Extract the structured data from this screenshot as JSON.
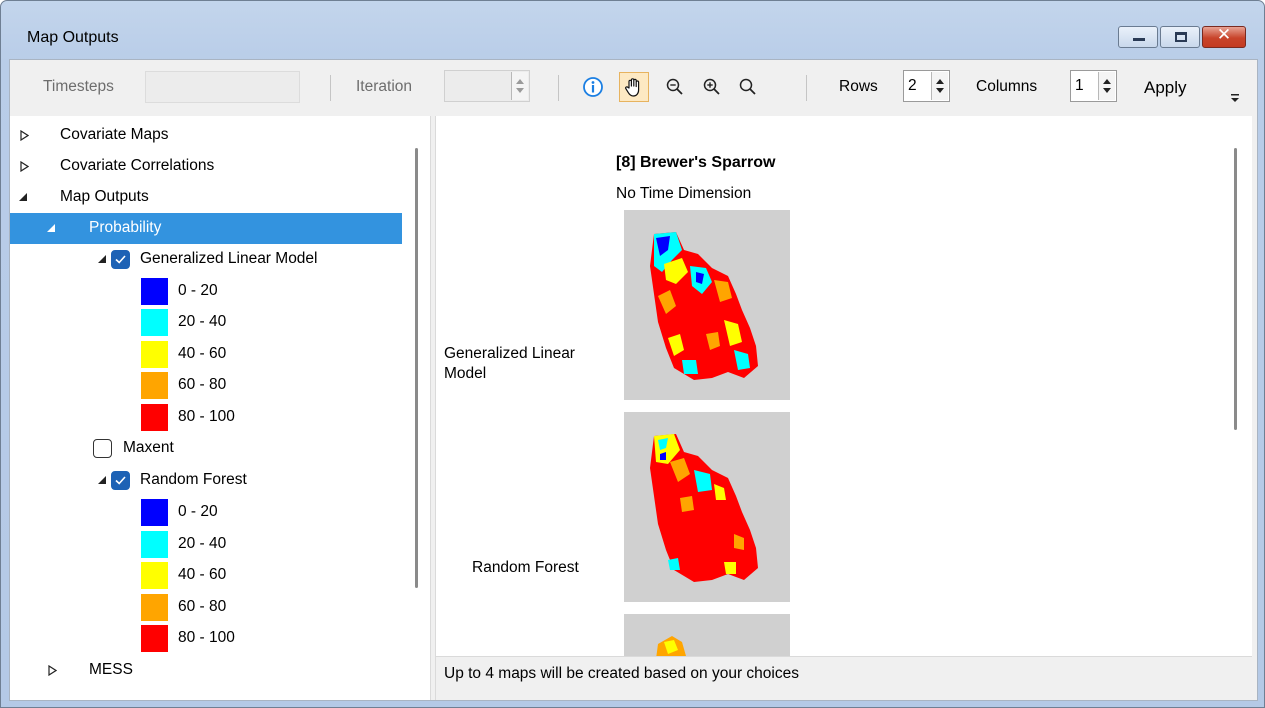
{
  "window": {
    "title": "Map Outputs",
    "buttons": [
      "minimize",
      "maximize",
      "close"
    ]
  },
  "toolbar": {
    "timesteps_label": "Timesteps",
    "timesteps_value": "",
    "iteration_label": "Iteration",
    "iteration_value": "",
    "tools": [
      "info-icon",
      "pan-hand-icon",
      "zoom-out-icon",
      "zoom-in-icon",
      "zoom-full-icon"
    ],
    "selected_tool": "pan-hand-icon",
    "rows_label": "Rows",
    "rows_value": "2",
    "columns_label": "Columns",
    "columns_value": "1",
    "apply_label": "Apply"
  },
  "tree": {
    "items": [
      {
        "label": "Covariate Maps",
        "state": "collapsed"
      },
      {
        "label": "Covariate Correlations",
        "state": "collapsed"
      },
      {
        "label": "Map Outputs",
        "state": "expanded"
      },
      {
        "label": "Probability",
        "state": "expanded",
        "selected": true
      },
      {
        "label": "Generalized Linear Model",
        "checked": true,
        "state": "expanded"
      },
      {
        "label": "Maxent",
        "checked": false
      },
      {
        "label": "Random Forest",
        "checked": true,
        "state": "expanded"
      },
      {
        "label": "MESS",
        "state": "collapsed"
      }
    ],
    "legend": [
      {
        "label": "0 - 20",
        "color": "#0000ff"
      },
      {
        "label": "20 - 40",
        "color": "#00ffff"
      },
      {
        "label": "40 - 60",
        "color": "#ffff00"
      },
      {
        "label": "60 - 80",
        "color": "#ffa500"
      },
      {
        "label": "80 - 100",
        "color": "#ff0000"
      }
    ]
  },
  "map": {
    "title": "[8] Brewer's Sparrow",
    "subtitle": "No Time Dimension",
    "rows": [
      {
        "label": "Generalized Linear Model"
      },
      {
        "label": "Random Forest"
      }
    ],
    "background_color": "#d0d0d0"
  },
  "status": {
    "text": "Up to 4 maps will be created based on your choices"
  }
}
